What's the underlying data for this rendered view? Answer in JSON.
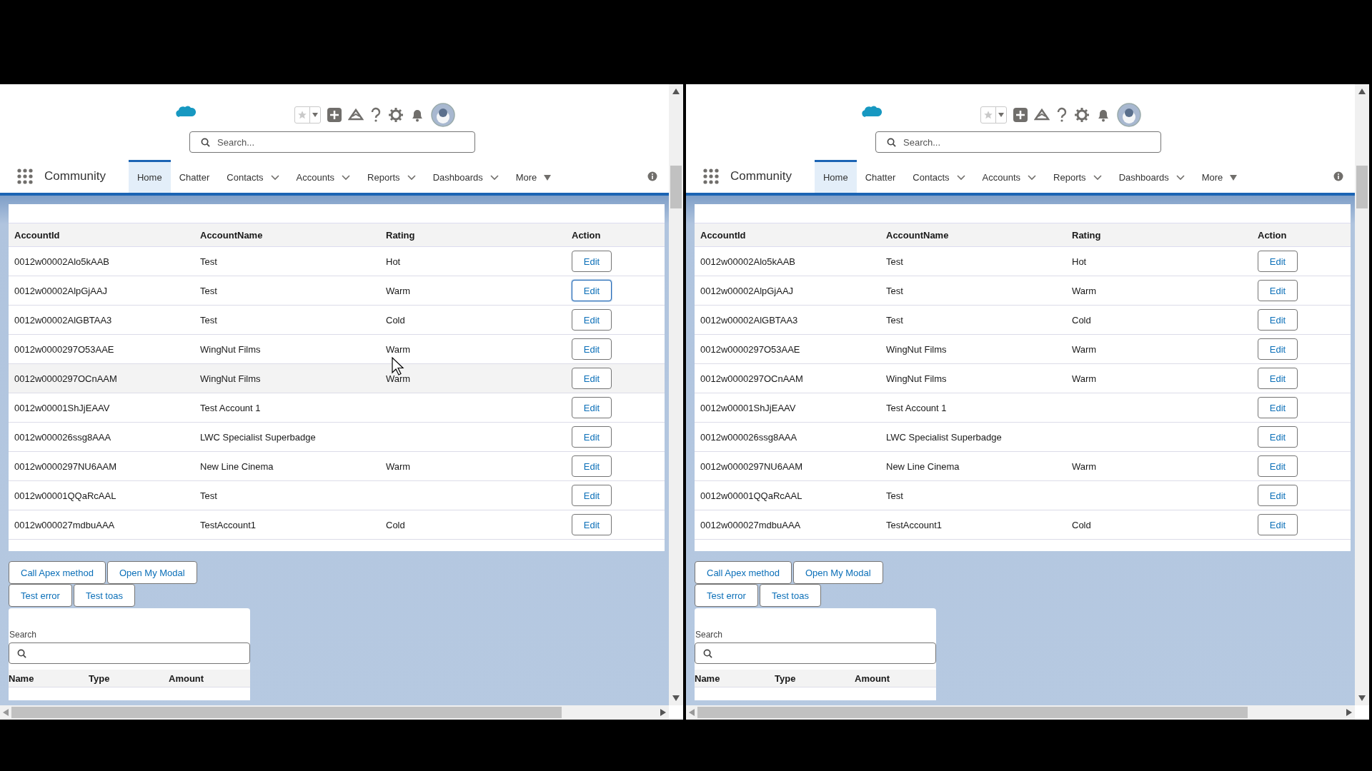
{
  "panes": [
    {
      "app_name": "Community",
      "search": {
        "placeholder": "Search..."
      },
      "pointer_visible": true,
      "nav": [
        {
          "label": "Home",
          "selected": true,
          "kind": "plain"
        },
        {
          "label": "Chatter",
          "selected": false,
          "kind": "plain"
        },
        {
          "label": "Contacts",
          "selected": false,
          "kind": "menu"
        },
        {
          "label": "Accounts",
          "selected": false,
          "kind": "menu"
        },
        {
          "label": "Reports",
          "selected": false,
          "kind": "menu"
        },
        {
          "label": "Dashboards",
          "selected": false,
          "kind": "menu"
        },
        {
          "label": "More",
          "selected": false,
          "kind": "overflow"
        }
      ],
      "table": {
        "columns": [
          "AccountId",
          "AccountName",
          "Rating",
          "Action"
        ],
        "rows": [
          {
            "account_id": "0012w00002Alo5kAAB",
            "account_name": "Test",
            "rating": "Hot",
            "action": "Edit",
            "hovered": false,
            "focused": false
          },
          {
            "account_id": "0012w00002AlpGjAAJ",
            "account_name": "Test",
            "rating": "Warm",
            "action": "Edit",
            "hovered": false,
            "focused": true
          },
          {
            "account_id": "0012w00002AlGBTAA3",
            "account_name": "Test",
            "rating": "Cold",
            "action": "Edit",
            "hovered": false,
            "focused": false
          },
          {
            "account_id": "0012w0000297O53AAE",
            "account_name": "WingNut Films",
            "rating": "Warm",
            "action": "Edit",
            "hovered": false,
            "focused": false
          },
          {
            "account_id": "0012w0000297OCnAAM",
            "account_name": "WingNut Films",
            "rating": "Warm",
            "action": "Edit",
            "hovered": true,
            "focused": false
          },
          {
            "account_id": "0012w00001ShJjEAAV",
            "account_name": "Test Account 1",
            "action": "Edit",
            "hovered": false,
            "focused": false
          },
          {
            "account_id": "0012w000026ssg8AAA",
            "account_name": "LWC Specialist Superbadge",
            "action": "Edit",
            "hovered": false,
            "focused": false
          },
          {
            "account_id": "0012w0000297NU6AAM",
            "account_name": "New Line Cinema",
            "rating": "Warm",
            "action": "Edit",
            "hovered": false,
            "focused": false
          },
          {
            "account_id": "0012w00001QQaRcAAL",
            "account_name": "Test",
            "action": "Edit",
            "hovered": false,
            "focused": false
          },
          {
            "account_id": "0012w000027mdbuAAA",
            "account_name": "TestAccount1",
            "rating": "Cold",
            "action": "Edit",
            "hovered": false,
            "focused": false
          }
        ]
      },
      "buttons": [
        [
          "Call Apex method",
          "Open My Modal"
        ],
        [
          "Test error",
          "Test toas"
        ]
      ],
      "search_panel": {
        "label": "Search",
        "columns": [
          "Name",
          "Type",
          "Amount"
        ]
      }
    },
    {
      "app_name": "Community",
      "search": {
        "placeholder": "Search..."
      },
      "pointer_visible": false,
      "nav": [
        {
          "label": "Home",
          "selected": true,
          "kind": "plain"
        },
        {
          "label": "Chatter",
          "selected": false,
          "kind": "plain"
        },
        {
          "label": "Contacts",
          "selected": false,
          "kind": "menu"
        },
        {
          "label": "Accounts",
          "selected": false,
          "kind": "menu"
        },
        {
          "label": "Reports",
          "selected": false,
          "kind": "menu"
        },
        {
          "label": "Dashboards",
          "selected": false,
          "kind": "menu"
        },
        {
          "label": "More",
          "selected": false,
          "kind": "overflow"
        }
      ],
      "table": {
        "columns": [
          "AccountId",
          "AccountName",
          "Rating",
          "Action"
        ],
        "rows": [
          {
            "account_id": "0012w00002Alo5kAAB",
            "account_name": "Test",
            "rating": "Hot",
            "action": "Edit",
            "hovered": false,
            "focused": false
          },
          {
            "account_id": "0012w00002AlpGjAAJ",
            "account_name": "Test",
            "rating": "Warm",
            "action": "Edit",
            "hovered": false,
            "focused": false
          },
          {
            "account_id": "0012w00002AlGBTAA3",
            "account_name": "Test",
            "rating": "Cold",
            "action": "Edit",
            "hovered": false,
            "focused": false
          },
          {
            "account_id": "0012w0000297O53AAE",
            "account_name": "WingNut Films",
            "rating": "Warm",
            "action": "Edit",
            "hovered": false,
            "focused": false
          },
          {
            "account_id": "0012w0000297OCnAAM",
            "account_name": "WingNut Films",
            "rating": "Warm",
            "action": "Edit",
            "hovered": false,
            "focused": false
          },
          {
            "account_id": "0012w00001ShJjEAAV",
            "account_name": "Test Account 1",
            "action": "Edit",
            "hovered": false,
            "focused": false
          },
          {
            "account_id": "0012w000026ssg8AAA",
            "account_name": "LWC Specialist Superbadge",
            "action": "Edit",
            "hovered": false,
            "focused": false
          },
          {
            "account_id": "0012w0000297NU6AAM",
            "account_name": "New Line Cinema",
            "rating": "Warm",
            "action": "Edit",
            "hovered": false,
            "focused": false
          },
          {
            "account_id": "0012w00001QQaRcAAL",
            "account_name": "Test",
            "action": "Edit",
            "hovered": false,
            "focused": false
          },
          {
            "account_id": "0012w000027mdbuAAA",
            "account_name": "TestAccount1",
            "rating": "Cold",
            "action": "Edit",
            "hovered": false,
            "focused": false
          }
        ]
      },
      "buttons": [
        [
          "Call Apex method",
          "Open My Modal"
        ],
        [
          "Test error",
          "Test toas"
        ]
      ],
      "search_panel": {
        "label": "Search",
        "columns": [
          "Name",
          "Type",
          "Amount"
        ]
      }
    }
  ]
}
